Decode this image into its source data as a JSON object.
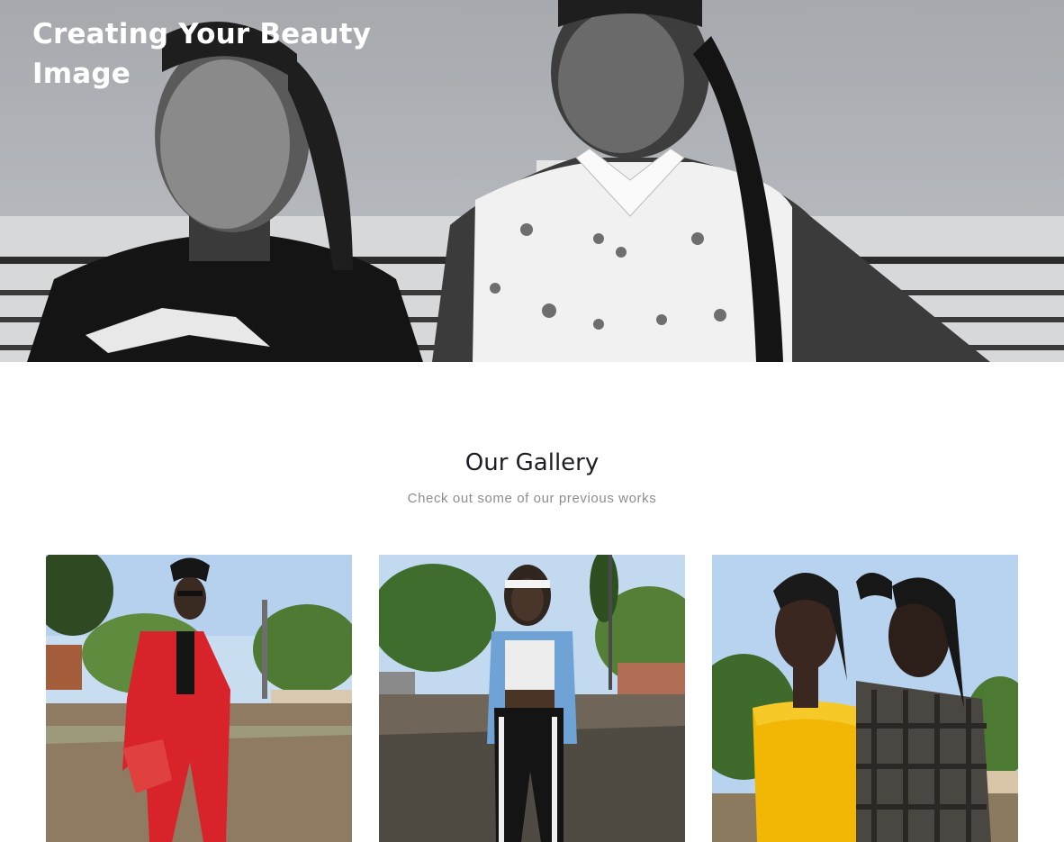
{
  "hero": {
    "title": "Creating Your Beauty Image",
    "image": "black-and-white-portrait-two-women"
  },
  "gallery": {
    "title": "Our Gallery",
    "subtitle": "Check out some of our previous works",
    "items": [
      {
        "image": "man-in-red-suit-on-street"
      },
      {
        "image": "woman-in-denim-jacket-on-road"
      },
      {
        "image": "two-women-yellow-and-plaid"
      }
    ]
  },
  "colors": {
    "hero_bg": "#a6a9ad",
    "text_dark": "#1c1f26",
    "text_muted": "#8a8d91",
    "sky": "#b9d4ee",
    "red_suit": "#d8232a",
    "yellow_top": "#f2b705",
    "denim": "#6fa3d6"
  }
}
